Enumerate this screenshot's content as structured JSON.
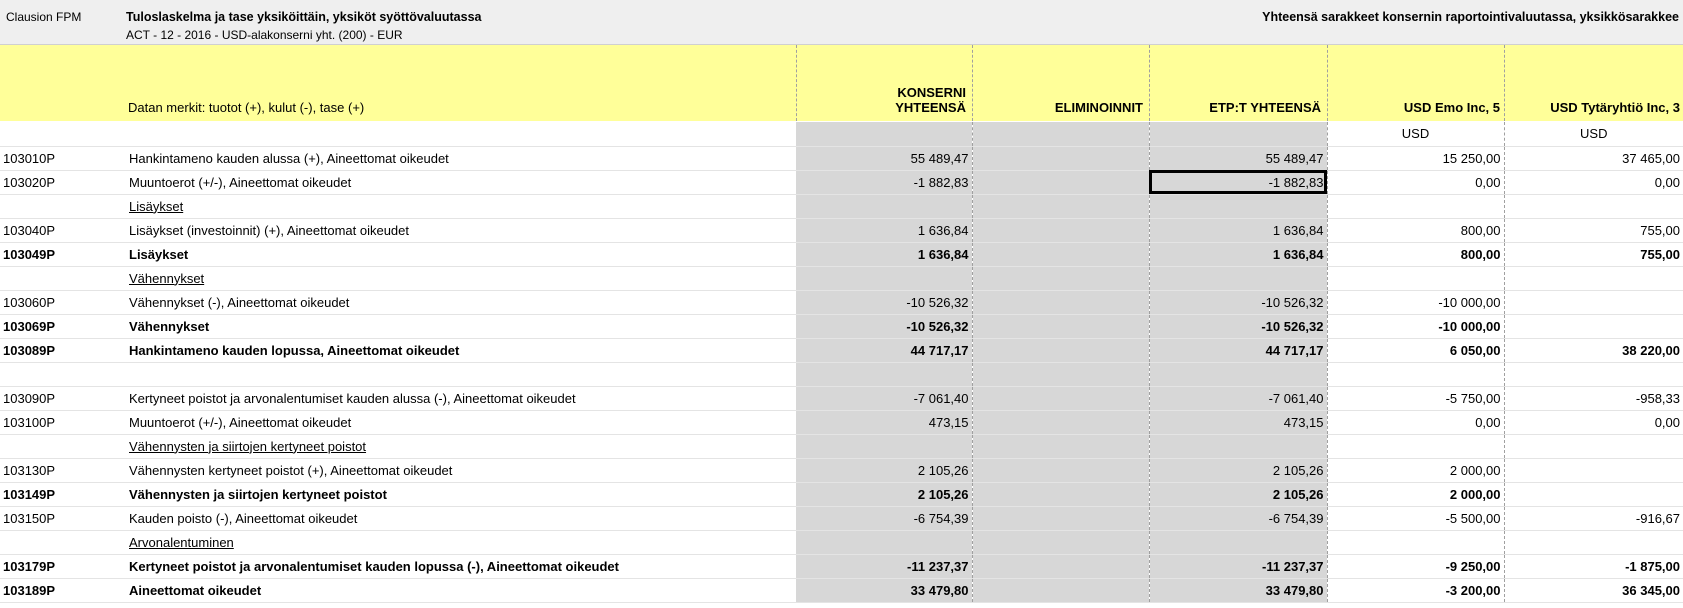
{
  "header": {
    "app_label": "Clausion FPM",
    "title": "Tuloslaskelma ja tase yksiköittäin, yksiköt syöttövaluutassa",
    "subtitle": "ACT - 12 - 2016 - USD-alakonserni yht. (200) - EUR",
    "right_note": "Yhteensä sarakkeet konsernin raportointivaluutassa, yksikkösarakkee"
  },
  "columns": {
    "desc_label": "Datan merkit: tuotot (+), kulut (-), tase (+)",
    "c1_line1": "KONSERNI",
    "c1_line2": "YHTEENSÄ",
    "c2": "ELIMINOINNIT",
    "c3": "ETP:T YHTEENSÄ",
    "c4": "USD Emo Inc, 5",
    "c5": "USD Tytäryhtiö Inc, 3",
    "c4_currency": "USD",
    "c5_currency": "USD"
  },
  "rows": [
    {
      "code": "103010P",
      "desc": "Hankintameno kauden alussa (+), Aineettomat oikeudet",
      "c1": "55 489,47",
      "c2": "",
      "c3": "55 489,47",
      "c4": "15 250,00",
      "c5": "37 465,00",
      "style": ""
    },
    {
      "code": "103020P",
      "desc": "Muuntoerot (+/-), Aineettomat oikeudet",
      "c1": "-1 882,83",
      "c2": "",
      "c3": "-1 882,83",
      "c4": "0,00",
      "c5": "0,00",
      "style": ""
    },
    {
      "code": "",
      "desc": "Lisäykset",
      "c1": "",
      "c2": "",
      "c3": "",
      "c4": "",
      "c5": "",
      "style": "ul"
    },
    {
      "code": "103040P",
      "desc": "Lisäykset (investoinnit) (+), Aineettomat oikeudet",
      "c1": "1 636,84",
      "c2": "",
      "c3": "1 636,84",
      "c4": "800,00",
      "c5": "755,00",
      "style": ""
    },
    {
      "code": "103049P",
      "desc": "Lisäykset",
      "c1": "1 636,84",
      "c2": "",
      "c3": "1 636,84",
      "c4": "800,00",
      "c5": "755,00",
      "style": "bold"
    },
    {
      "code": "",
      "desc": "Vähennykset",
      "c1": "",
      "c2": "",
      "c3": "",
      "c4": "",
      "c5": "",
      "style": "ul"
    },
    {
      "code": "103060P",
      "desc": "Vähennykset (-), Aineettomat oikeudet",
      "c1": "-10 526,32",
      "c2": "",
      "c3": "-10 526,32",
      "c4": "-10 000,00",
      "c5": "",
      "style": ""
    },
    {
      "code": "103069P",
      "desc": "Vähennykset",
      "c1": "-10 526,32",
      "c2": "",
      "c3": "-10 526,32",
      "c4": "-10 000,00",
      "c5": "",
      "style": "bold"
    },
    {
      "code": "103089P",
      "desc": "Hankintameno kauden lopussa, Aineettomat oikeudet",
      "c1": "44 717,17",
      "c2": "",
      "c3": "44 717,17",
      "c4": "6 050,00",
      "c5": "38 220,00",
      "style": "bold"
    },
    {
      "code": "",
      "desc": "",
      "c1": "",
      "c2": "",
      "c3": "",
      "c4": "",
      "c5": "",
      "style": ""
    },
    {
      "code": "103090P",
      "desc": "Kertyneet poistot ja arvonalentumiset kauden alussa (-), Aineettomat oikeudet",
      "c1": "-7 061,40",
      "c2": "",
      "c3": "-7 061,40",
      "c4": "-5 750,00",
      "c5": "-958,33",
      "style": ""
    },
    {
      "code": "103100P",
      "desc": "Muuntoerot (+/-), Aineettomat oikeudet",
      "c1": "473,15",
      "c2": "",
      "c3": "473,15",
      "c4": "0,00",
      "c5": "0,00",
      "style": ""
    },
    {
      "code": "",
      "desc": "Vähennysten ja siirtojen kertyneet poistot",
      "c1": "",
      "c2": "",
      "c3": "",
      "c4": "",
      "c5": "",
      "style": "ul"
    },
    {
      "code": "103130P",
      "desc": "Vähennysten kertyneet poistot (+), Aineettomat oikeudet",
      "c1": "2 105,26",
      "c2": "",
      "c3": "2 105,26",
      "c4": "2 000,00",
      "c5": "",
      "style": ""
    },
    {
      "code": "103149P",
      "desc": "Vähennysten ja siirtojen kertyneet poistot",
      "c1": "2 105,26",
      "c2": "",
      "c3": "2 105,26",
      "c4": "2 000,00",
      "c5": "",
      "style": "bold"
    },
    {
      "code": "103150P",
      "desc": "Kauden poisto (-), Aineettomat oikeudet",
      "c1": "-6 754,39",
      "c2": "",
      "c3": "-6 754,39",
      "c4": "-5 500,00",
      "c5": "-916,67",
      "style": ""
    },
    {
      "code": "",
      "desc": "Arvonalentuminen",
      "c1": "",
      "c2": "",
      "c3": "",
      "c4": "",
      "c5": "",
      "style": "ul"
    },
    {
      "code": "103179P",
      "desc": "Kertyneet poistot ja arvonalentumiset kauden lopussa (-), Aineettomat oikeudet",
      "c1": "-11 237,37",
      "c2": "",
      "c3": "-11 237,37",
      "c4": "-9 250,00",
      "c5": "-1 875,00",
      "style": "bold"
    },
    {
      "code": "103189P",
      "desc": "Aineettomat oikeudet",
      "c1": "33 479,80",
      "c2": "",
      "c3": "33 479,80",
      "c4": "-3 200,00",
      "c5": "36 345,00",
      "style": "bold"
    }
  ],
  "selection": {
    "row": 1,
    "col": "c3"
  }
}
